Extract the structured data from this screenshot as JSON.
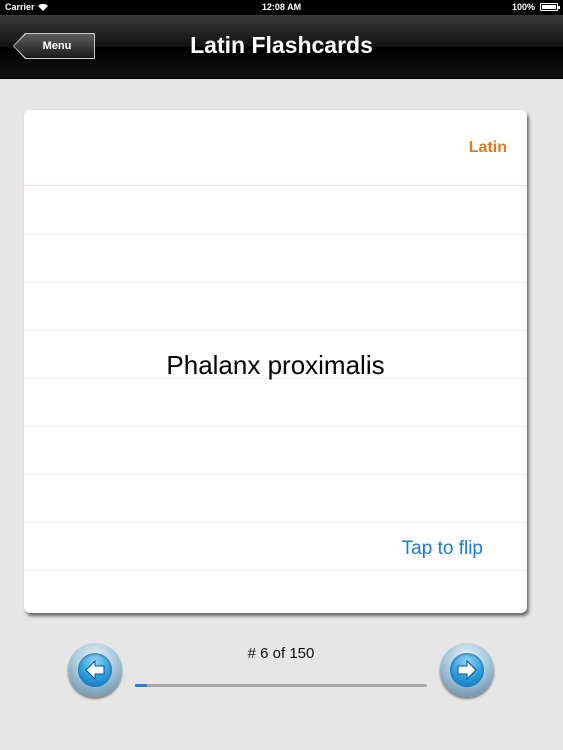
{
  "status": {
    "carrier": "Carrier",
    "time": "12:08 AM",
    "battery": "100%"
  },
  "nav": {
    "menu_label": "Menu",
    "title": "Latin Flashcards"
  },
  "card": {
    "language": "Latin",
    "term": "Phalanx proximalis",
    "hint": "Tap to flip"
  },
  "progress": {
    "label": "# 6 of 150",
    "current": 6,
    "total": 150
  },
  "icons": {
    "prev": "arrow-left-icon",
    "next": "arrow-right-icon"
  },
  "colors": {
    "accent_orange": "#e07a1a",
    "link_blue": "#1a7bd6",
    "progress_blue": "#2b7fd3"
  }
}
